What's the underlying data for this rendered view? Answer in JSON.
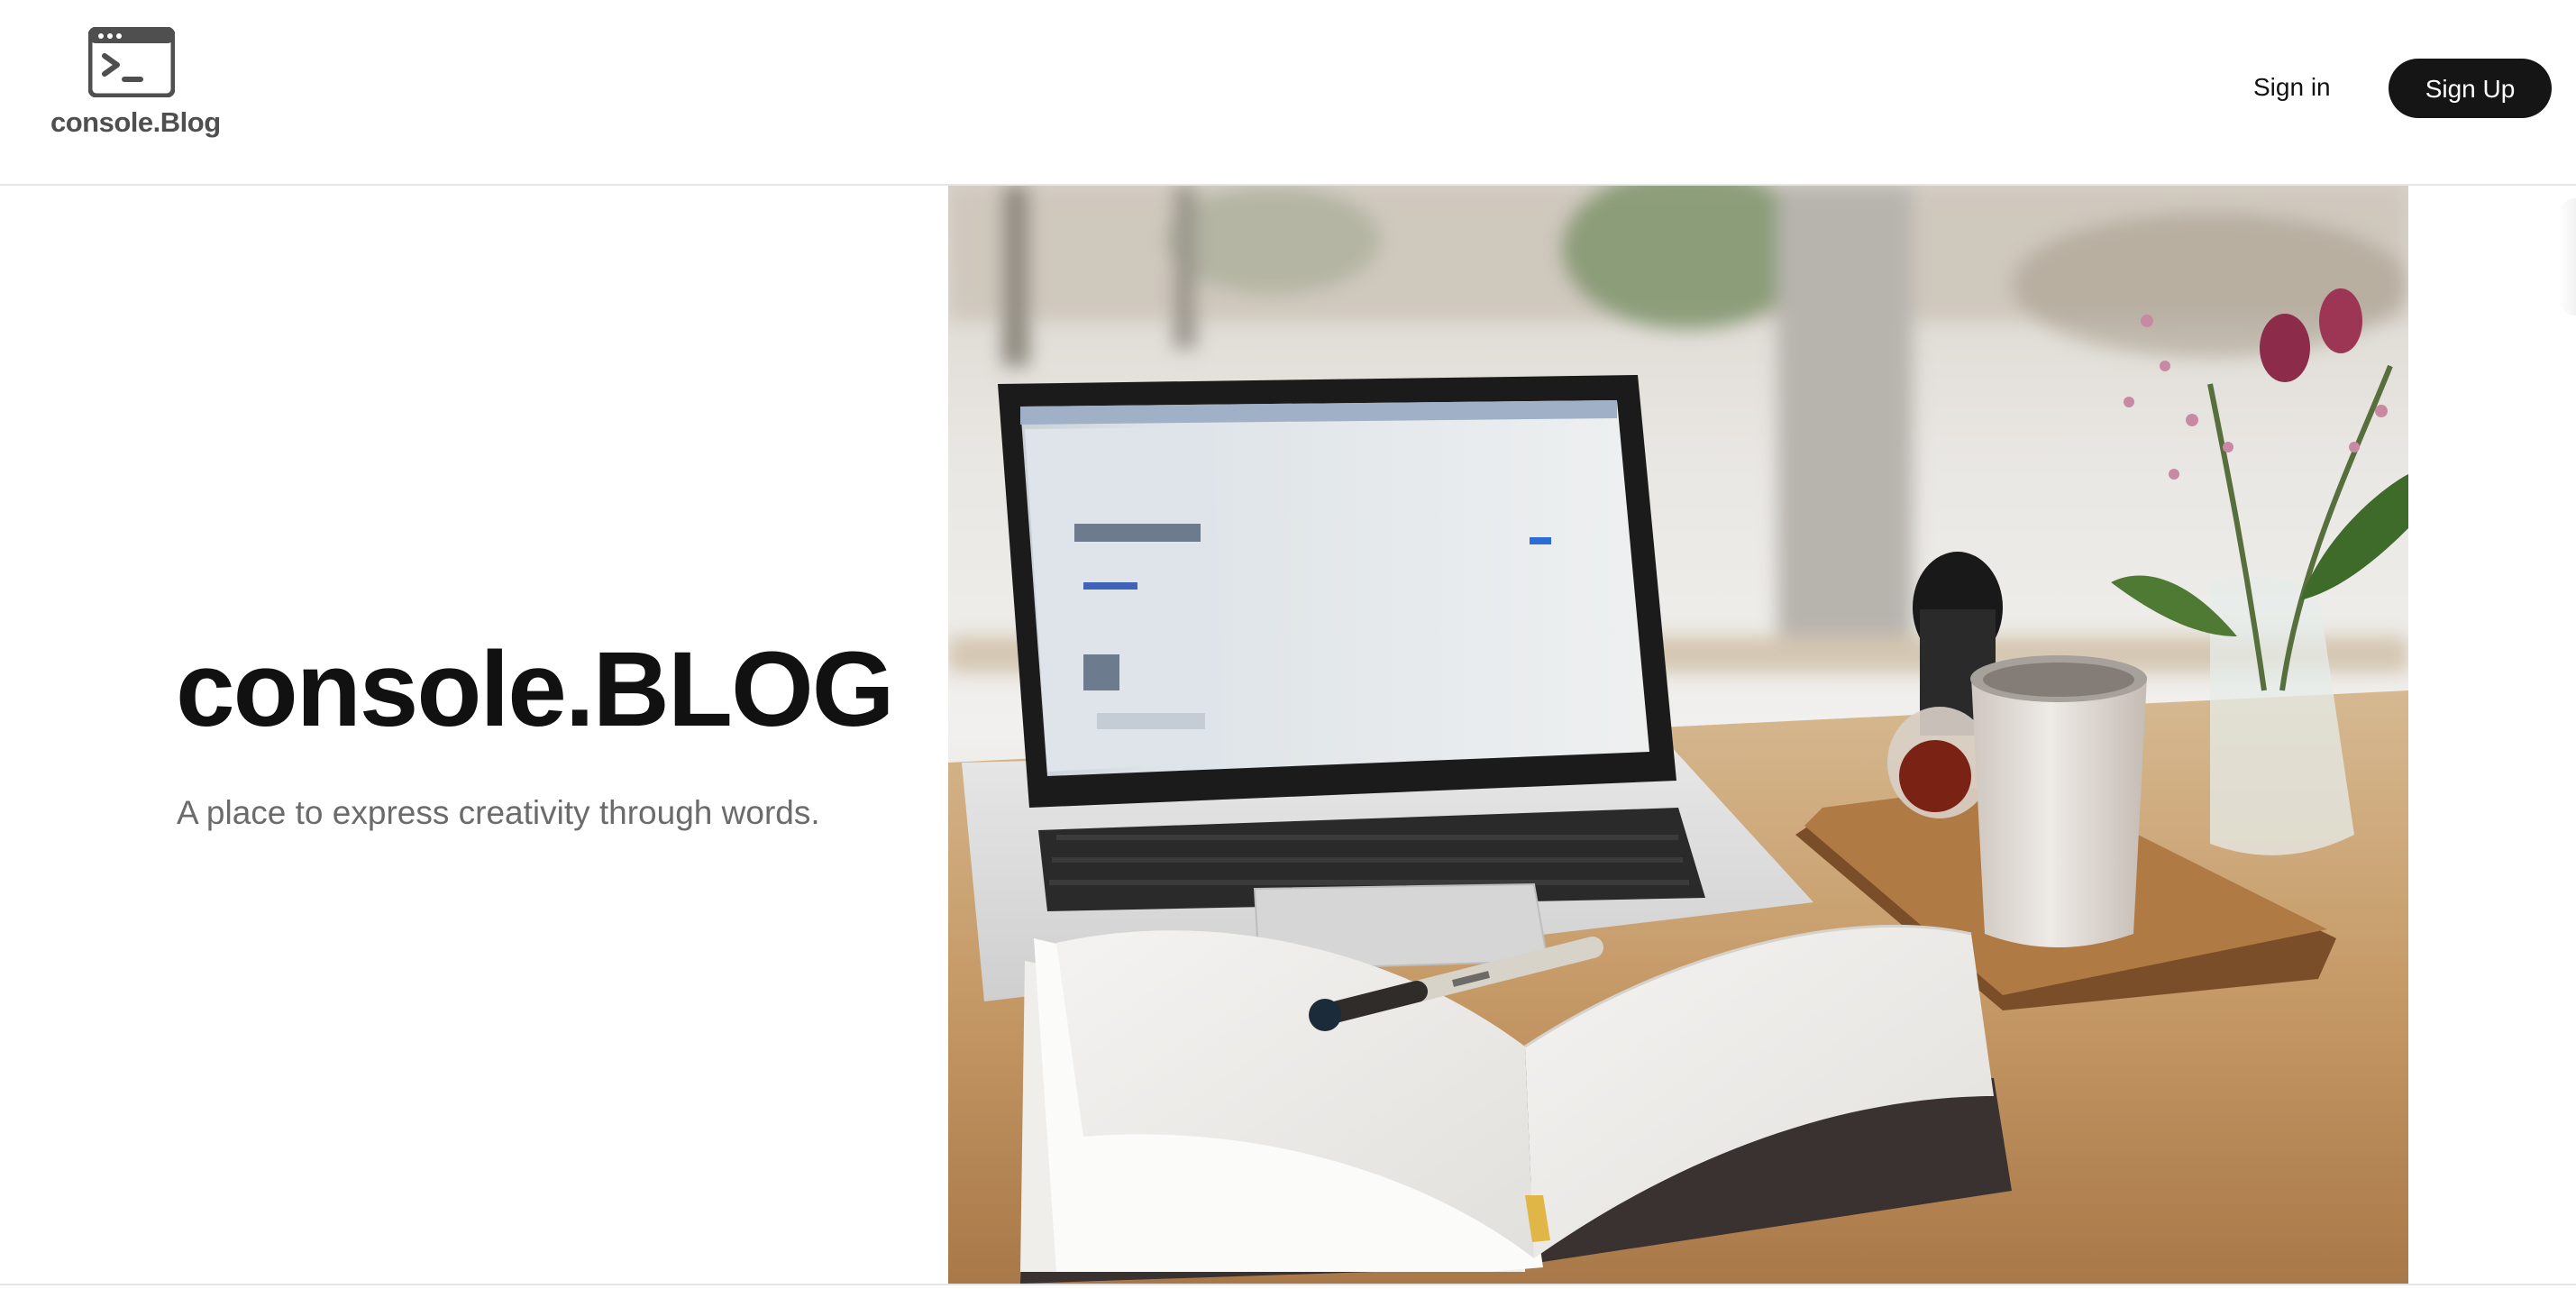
{
  "header": {
    "brand_name": "console.Blog",
    "signin_label": "Sign in",
    "signup_label": "Sign Up"
  },
  "hero": {
    "title": "console.BLOG",
    "subtitle": "A place to express creativity through words."
  },
  "icons": {
    "logo": "terminal-window-icon"
  },
  "colors": {
    "primary_button": "#151515",
    "title_text": "#111111",
    "subtitle_text": "#6b6b6b",
    "brand_text": "#4f4f4f"
  }
}
